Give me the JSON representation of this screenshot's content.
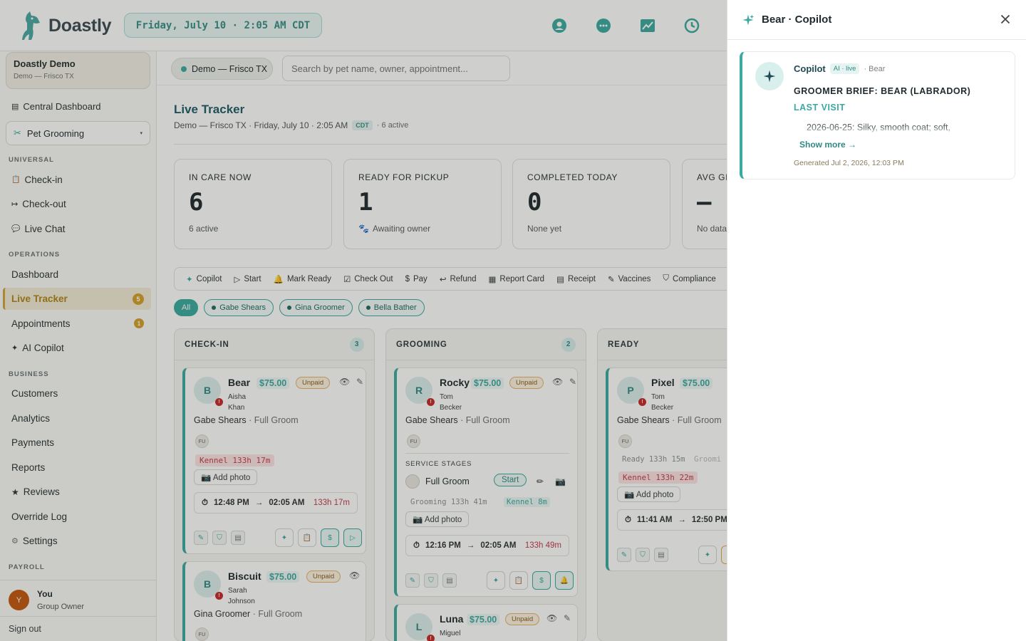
{
  "app": {
    "name": "Doastly",
    "datetime": "Friday, July 10 · 2:05 AM CDT"
  },
  "sidebar": {
    "org": {
      "name": "Doastly Demo",
      "sub": "Demo — Frisco TX"
    },
    "central": "Central Dashboard",
    "module": "Pet Grooming",
    "sections": {
      "universal": "UNIVERSAL",
      "operations": "OPERATIONS",
      "business": "BUSINESS",
      "payroll": "PAYROLL"
    },
    "universal": [
      "Check-in",
      "Check-out",
      "Live Chat"
    ],
    "operations": {
      "dashboard": "Dashboard",
      "live_tracker": "Live Tracker",
      "live_tracker_badge": "5",
      "appointments": "Appointments",
      "appointments_badge": "1",
      "ai_copilot": "AI Copilot"
    },
    "business": [
      "Customers",
      "Analytics",
      "Payments",
      "Reports",
      "Reviews",
      "Override Log",
      "Settings"
    ],
    "user": {
      "initial": "Y",
      "name": "You",
      "role": "Group Owner"
    },
    "signout": "Sign out"
  },
  "main": {
    "location": "Demo — Frisco TX",
    "search_placeholder": "Search by pet name, owner, appointment...",
    "title": "Live Tracker",
    "subtitle": "Demo — Frisco TX · Friday, July 10 · 2:05 AM",
    "tz": "CDT",
    "active": "· 6 active",
    "stats": [
      {
        "label": "IN CARE NOW",
        "value": "6",
        "note": "6 active"
      },
      {
        "label": "READY FOR PICKUP",
        "value": "1",
        "note": "Awaiting owner"
      },
      {
        "label": "COMPLETED TODAY",
        "value": "0",
        "note": "None yet"
      },
      {
        "label": "AVG GI",
        "value": "—",
        "note": "No data"
      }
    ],
    "actions": [
      "Copilot",
      "Start",
      "Mark Ready",
      "Check Out",
      "Pay",
      "Refund",
      "Report Card",
      "Receipt",
      "Vaccines",
      "Compliance"
    ],
    "filters": [
      "All",
      "Gabe Shears",
      "Gina Groomer",
      "Bella Bather"
    ],
    "columns": [
      {
        "title": "CHECK-IN",
        "count": "3"
      },
      {
        "title": "GROOMING",
        "count": "2"
      },
      {
        "title": "READY",
        "count": ""
      }
    ],
    "cards": {
      "bear": {
        "initial": "B",
        "name": "Bear",
        "price": "$75.00",
        "status": "Unpaid",
        "owner_first": "Aisha",
        "owner_last": "Khan",
        "groomer": "Gabe Shears",
        "service": "· Full Groom",
        "fu": "FU",
        "kennel": "Kennel 133h 17m",
        "add_photo": "📷 Add photo",
        "start": "12:48 PM",
        "end": "02:05 AM",
        "elapsed": "133h 17m"
      },
      "biscuit": {
        "initial": "B",
        "name": "Biscuit",
        "price": "$75.00",
        "status": "Unpaid",
        "owner_first": "Sarah",
        "owner_last": "Johnson",
        "groomer": "Gina Groomer",
        "service": "· Full Groom",
        "fu": "FU"
      },
      "rocky": {
        "initial": "R",
        "name": "Rocky",
        "price": "$75.00",
        "status": "Unpaid",
        "owner_first": "Tom",
        "owner_last": "Becker",
        "groomer": "Gabe Shears",
        "service": "· Full Groom",
        "fu": "FU",
        "stages_label": "SERVICE STAGES",
        "stage_name": "Full Groom",
        "stage_btn": "Start",
        "grooming": "Grooming 133h 41m",
        "kennel": "Kennel 8m",
        "add_photo": "📷 Add photo",
        "start": "12:16 PM",
        "end": "02:05 AM",
        "elapsed": "133h 49m"
      },
      "luna": {
        "initial": "L",
        "name": "Luna",
        "price": "$75.00",
        "status": "Unpaid",
        "owner_first": "Miguel"
      },
      "pixel": {
        "initial": "P",
        "name": "Pixel",
        "price": "$75.00",
        "owner_first": "Tom",
        "owner_last": "Becker",
        "groomer": "Gabe Shears",
        "service": "· Full Groom",
        "fu": "FU",
        "ready": "Ready 133h 15m",
        "grooming": "Groomi",
        "kennel": "Kennel 133h 22m",
        "add_photo": "📷 Add photo",
        "start": "11:41 AM",
        "end": "12:50 PM"
      }
    }
  },
  "drawer": {
    "title": "Bear · Copilot",
    "brief": {
      "name": "Copilot",
      "badge": "AI · live",
      "pet": "· Bear",
      "heading": "GROOMER BRIEF: BEAR (LABRADOR)",
      "section": "LAST VISIT",
      "body": "2026-06-25: Silky, smooth coat; soft,",
      "show_more": "Show more →",
      "generated": "Generated Jul 2, 2026, 12:03 PM"
    }
  },
  "colors": {
    "accent": "#3aa9a1",
    "amber": "#d4a02a",
    "danger": "#c62828"
  }
}
